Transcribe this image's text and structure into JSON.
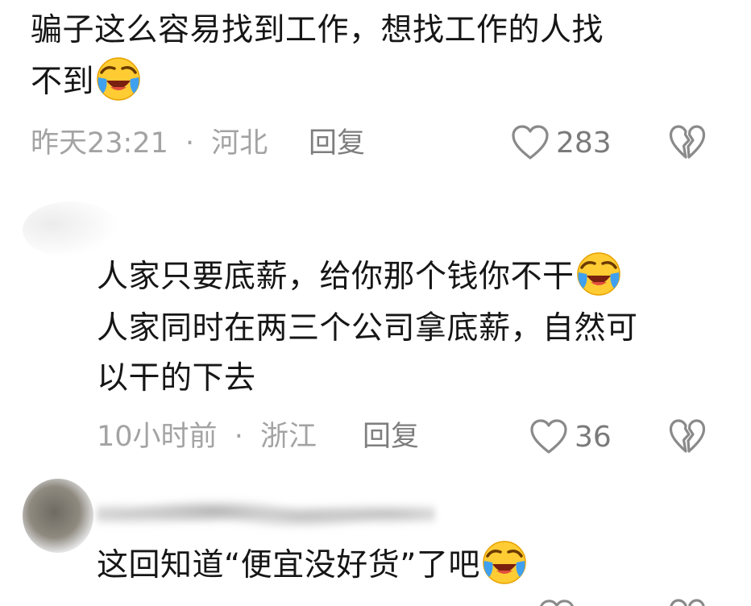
{
  "comments": [
    {
      "lines": [
        "骗子这么容易找到工作，想找工作的人找",
        "不到"
      ],
      "time": "昨天23:21",
      "location": "河北",
      "reply_label": "回复",
      "likes": "283"
    },
    {
      "lines": [
        "人家只要底薪，给你那个钱你不干",
        "人家同时在两三个公司拿底薪，自然可",
        "以干的下去"
      ],
      "time": "10小时前",
      "location": "浙江",
      "reply_label": "回复",
      "likes": "36"
    },
    {
      "lines": [
        "这回知道“便宜没好货”了吧"
      ]
    }
  ],
  "meta_separator": "·",
  "emoji_name": "grinning-squinting-tears-emoji",
  "colors": {
    "text": "#161616",
    "meta": "#a3a3a3",
    "reply": "#7e7e7e",
    "icon": "#8a8a8a"
  }
}
